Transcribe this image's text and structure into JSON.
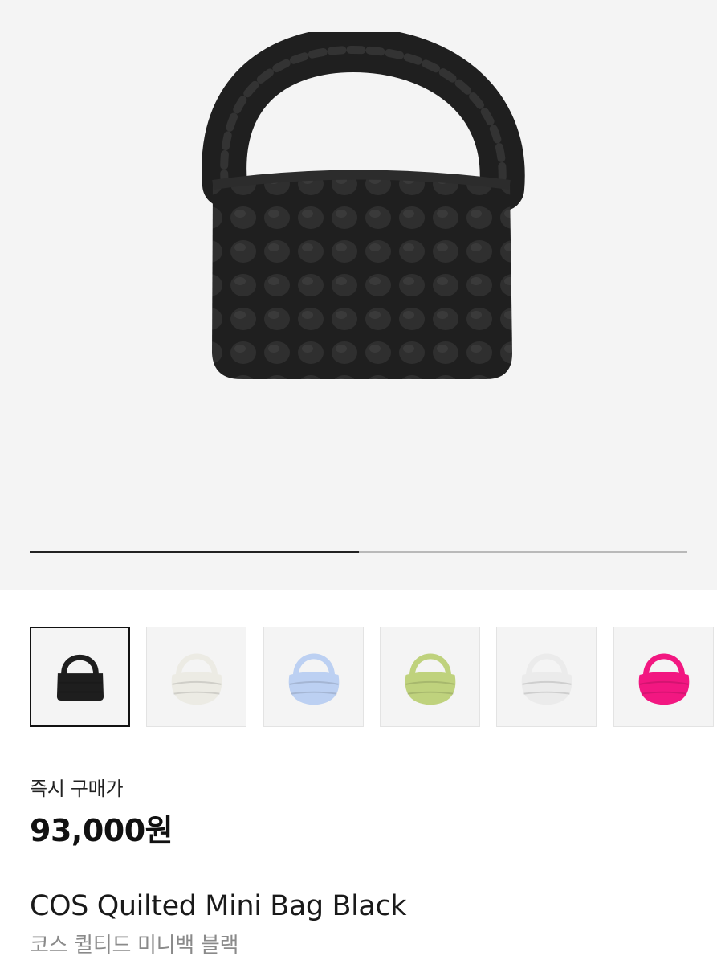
{
  "gallery": {
    "main_image_icon": "quilted-bag-black",
    "progress_fraction": 0.5,
    "active_index": 0
  },
  "thumbnails": [
    {
      "color_name": "black",
      "color": "#1e1e1e"
    },
    {
      "color_name": "cream",
      "color": "#ecebe4"
    },
    {
      "color_name": "light-blue",
      "color": "#bcd0f2"
    },
    {
      "color_name": "lime-green",
      "color": "#bfd27d"
    },
    {
      "color_name": "white",
      "color": "#ebebeb"
    },
    {
      "color_name": "hot-pink",
      "color": "#f21781"
    }
  ],
  "price": {
    "label": "즉시 구매가",
    "value": "93,000원"
  },
  "product": {
    "title_en": "COS Quilted Mini Bag Black",
    "title_ko": "코스 퀼티드 미니백 블랙"
  }
}
